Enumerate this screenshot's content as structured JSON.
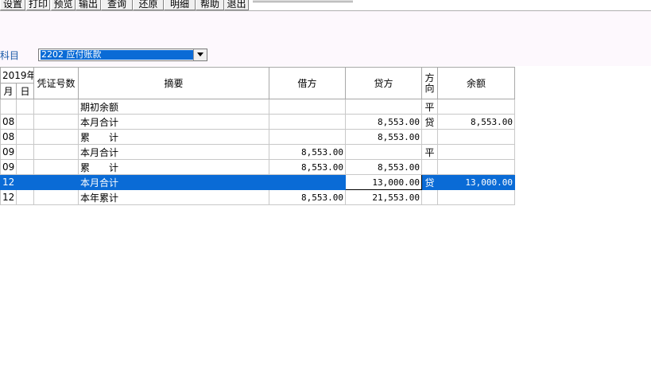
{
  "toolbar": {
    "buttons": [
      {
        "label": "设置"
      },
      {
        "label": "打印"
      },
      {
        "label": "预览"
      },
      {
        "label": "输出"
      },
      {
        "label": "查询"
      },
      {
        "label": "还原"
      },
      {
        "label": "明细"
      },
      {
        "label": "帮助"
      },
      {
        "label": "退出"
      }
    ]
  },
  "filter": {
    "subject_label": "科目",
    "subject_value": "2202 应付账款"
  },
  "table": {
    "headers": {
      "year": "2019年",
      "month": "月",
      "day": "日",
      "voucher_no": "凭证号数",
      "summary": "摘要",
      "debit": "借方",
      "credit": "贷方",
      "direction": "方向",
      "balance": "余额"
    },
    "rows": [
      {
        "month": "",
        "day": "",
        "voucher": "",
        "summary": "期初余额",
        "debit": "",
        "credit": "",
        "direction": "平",
        "balance": ""
      },
      {
        "month": "08",
        "day": "",
        "voucher": "",
        "summary": "本月合计",
        "debit": "",
        "credit": "8,553.00",
        "direction": "贷",
        "balance": "8,553.00"
      },
      {
        "month": "08",
        "day": "",
        "voucher": "",
        "summary": "累　　计",
        "debit": "",
        "credit": "8,553.00",
        "direction": "",
        "balance": ""
      },
      {
        "month": "09",
        "day": "",
        "voucher": "",
        "summary": "本月合计",
        "debit": "8,553.00",
        "credit": "",
        "direction": "平",
        "balance": ""
      },
      {
        "month": "09",
        "day": "",
        "voucher": "",
        "summary": "累　　计",
        "debit": "8,553.00",
        "credit": "8,553.00",
        "direction": "",
        "balance": ""
      },
      {
        "month": "12",
        "day": "",
        "voucher": "",
        "summary": "本月合计",
        "debit": "",
        "credit": "13,000.00",
        "direction": "贷",
        "balance": "13,000.00",
        "selected": true
      },
      {
        "month": "12",
        "day": "",
        "voucher": "",
        "summary": "本年累计",
        "debit": "8,553.00",
        "credit": "21,553.00",
        "direction": "",
        "balance": ""
      }
    ]
  },
  "colors": {
    "selection": "#0a6bd6",
    "label_blue": "#1a5aa8",
    "panel_bg": "#fdf8fd"
  }
}
